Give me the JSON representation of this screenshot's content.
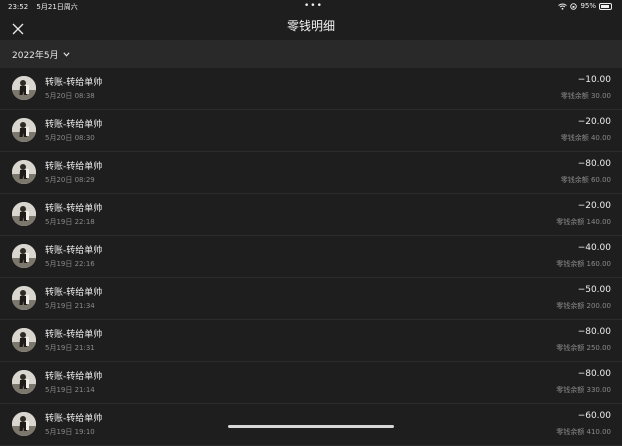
{
  "status_bar": {
    "time": "23:52",
    "date": "5月21日周六",
    "battery": "95%"
  },
  "header": {
    "title": "零钱明细"
  },
  "filter": {
    "month": "2022年5月"
  },
  "transactions": [
    {
      "title": "转账-转给单帅",
      "time": "5月20日 08:38",
      "amount": "−10.00",
      "balance": "零钱余额 30.00"
    },
    {
      "title": "转账-转给单帅",
      "time": "5月20日 08:30",
      "amount": "−20.00",
      "balance": "零钱余额 40.00"
    },
    {
      "title": "转账-转给单帅",
      "time": "5月20日 08:29",
      "amount": "−80.00",
      "balance": "零钱余额 60.00"
    },
    {
      "title": "转账-转给单帅",
      "time": "5月19日 22:18",
      "amount": "−20.00",
      "balance": "零钱余额 140.00"
    },
    {
      "title": "转账-转给单帅",
      "time": "5月19日 22:16",
      "amount": "−40.00",
      "balance": "零钱余额 160.00"
    },
    {
      "title": "转账-转给单帅",
      "time": "5月19日 21:34",
      "amount": "−50.00",
      "balance": "零钱余额 200.00"
    },
    {
      "title": "转账-转给单帅",
      "time": "5月19日 21:31",
      "amount": "−80.00",
      "balance": "零钱余额 250.00"
    },
    {
      "title": "转账-转给单帅",
      "time": "5月19日 21:14",
      "amount": "−80.00",
      "balance": "零钱余额 330.00"
    },
    {
      "title": "转账-转给单帅",
      "time": "5月19日 19:10",
      "amount": "−60.00",
      "balance": "零钱余额 410.00"
    }
  ]
}
